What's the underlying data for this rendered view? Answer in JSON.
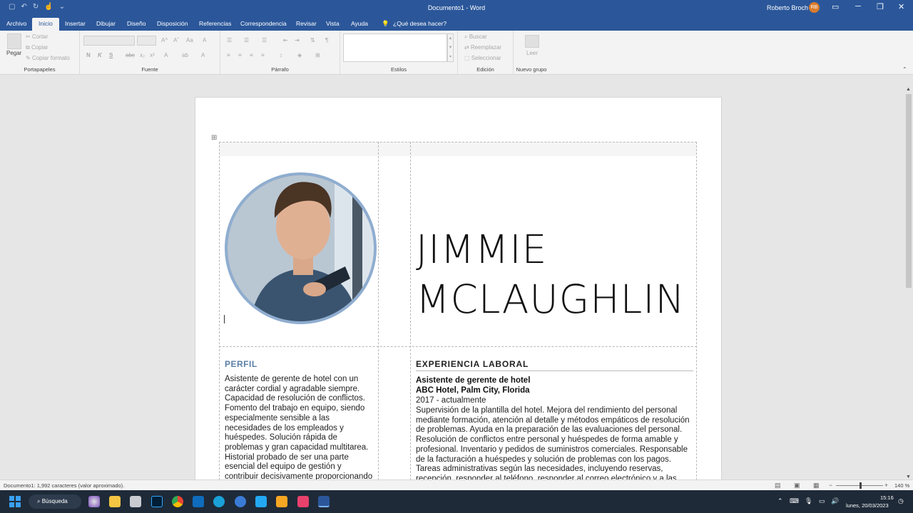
{
  "titlebar": {
    "document_title": "Documento1 - Word",
    "user_name": "Roberto Broch",
    "avatar_initials": "RB",
    "min": "─",
    "restore": "❐",
    "close": "✕",
    "ribbon_display": "▭"
  },
  "tabs": [
    "Archivo",
    "Inicio",
    "Insertar",
    "Dibujar",
    "Diseño",
    "Disposición",
    "Referencias",
    "Correspondencia",
    "Revisar",
    "Vista",
    "Ayuda"
  ],
  "tell_me": "¿Qué desea hacer?",
  "ribbon": {
    "clipboard": {
      "paste": "Pegar",
      "cut": "Cortar",
      "copy": "Copiar",
      "format_painter": "Copiar formato",
      "label": "Portapapeles"
    },
    "font": {
      "label": "Fuente",
      "bold": "N",
      "italic": "K",
      "underline": "S",
      "strike": "abc",
      "sub": "x₂",
      "sup": "x²",
      "grow": "A^",
      "shrink": "Aˇ",
      "case": "Aa",
      "clear": "A",
      "effects": "A",
      "highlight": "ab",
      "color": "A"
    },
    "paragraph": {
      "label": "Párrafo",
      "show": "¶"
    },
    "styles": {
      "label": "Estilos"
    },
    "editing": {
      "label": "Edición",
      "find": "Buscar",
      "replace": "Reemplazar",
      "select": "Seleccionar"
    },
    "custom": {
      "label": "Nuevo grupo",
      "read": "Leer"
    }
  },
  "document": {
    "name_line1": "JIMMIE",
    "name_line2": "MCLAUGHLIN",
    "profile_heading": "PERFIL",
    "profile_text": "Asistente de gerente de hotel con un carácter cordial y agradable siempre. Capacidad de resolución de conflictos. Fomento del trabajo en equipo, siendo especialmente sensible a las necesidades de los empleados y huéspedes. Solución rápida de problemas y gran capacidad multitarea. Historial probado de ser una parte esencial del equipo de gestión y contribuir decisivamente proporcionando soluciones efectivas que producen un",
    "experience_heading": "EXPERIENCIA LABORAL",
    "job_title": "Asistente de gerente de hotel",
    "job_company": "ABC Hotel, Palm City, Florida",
    "job_dates": "2017 - actualmente",
    "job_description": "Supervisión de la plantilla del hotel. Mejora del rendimiento del personal mediante formación, atención al detalle y métodos empáticos de resolución de problemas. Ayuda en la preparación de las evaluaciones del personal. Resolución de conflictos entre personal y huéspedes de forma amable y profesional. Inventario y pedidos de suministros comerciales. Responsable de la facturación a huéspedes y solución de problemas con los pagos. Tareas administrativas según las necesidades, incluyendo reservas, recepción, responder al teléfono, responder al correo electrónico y a las consultas en redes sociales."
  },
  "status": {
    "word_count": "Documento1: 1,992 caracteres (valor aproximado).",
    "zoom": "140 %"
  },
  "taskbar": {
    "search": "Búsqueda",
    "time": "15:16",
    "date": "lunes, 20/03/2023"
  },
  "colors": {
    "word_blue": "#2b579a",
    "accent_heading": "#5a7fa6",
    "photo_border": "#8fadd0"
  }
}
